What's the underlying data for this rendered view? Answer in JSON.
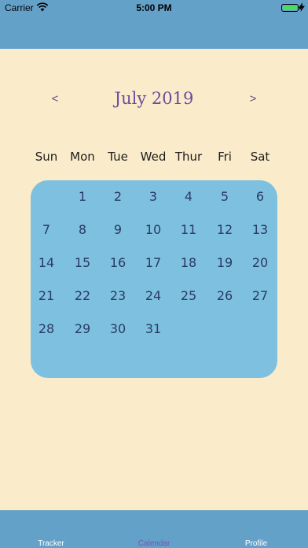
{
  "status_bar": {
    "carrier": "Carrier",
    "time": "5:00 PM",
    "battery_level": 1.0
  },
  "calendar": {
    "prev_label": "<",
    "next_label": ">",
    "title": "July 2019",
    "weekdays": [
      "Sun",
      "Mon",
      "Tue",
      "Wed",
      "Thur",
      "Fri",
      "Sat"
    ],
    "days": [
      [
        "",
        "1",
        "2",
        "3",
        "4",
        "5",
        "6"
      ],
      [
        "7",
        "8",
        "9",
        "10",
        "11",
        "12",
        "13"
      ],
      [
        "14",
        "15",
        "16",
        "17",
        "18",
        "19",
        "20"
      ],
      [
        "21",
        "22",
        "23",
        "24",
        "25",
        "26",
        "27"
      ],
      [
        "28",
        "29",
        "30",
        "31",
        "",
        "",
        ""
      ]
    ],
    "panel_color": "#7ec0df",
    "title_color": "#6a4c9c"
  },
  "tab_bar": {
    "tabs": [
      {
        "label": "Tracker",
        "selected": false
      },
      {
        "label": "Calendar",
        "selected": true
      },
      {
        "label": "Profile",
        "selected": false
      }
    ],
    "selected_color": "#7257b4",
    "default_color": "#ffffff",
    "background": "#64a1c8"
  },
  "colors": {
    "background": "#faecca",
    "header": "#64a1c8"
  }
}
